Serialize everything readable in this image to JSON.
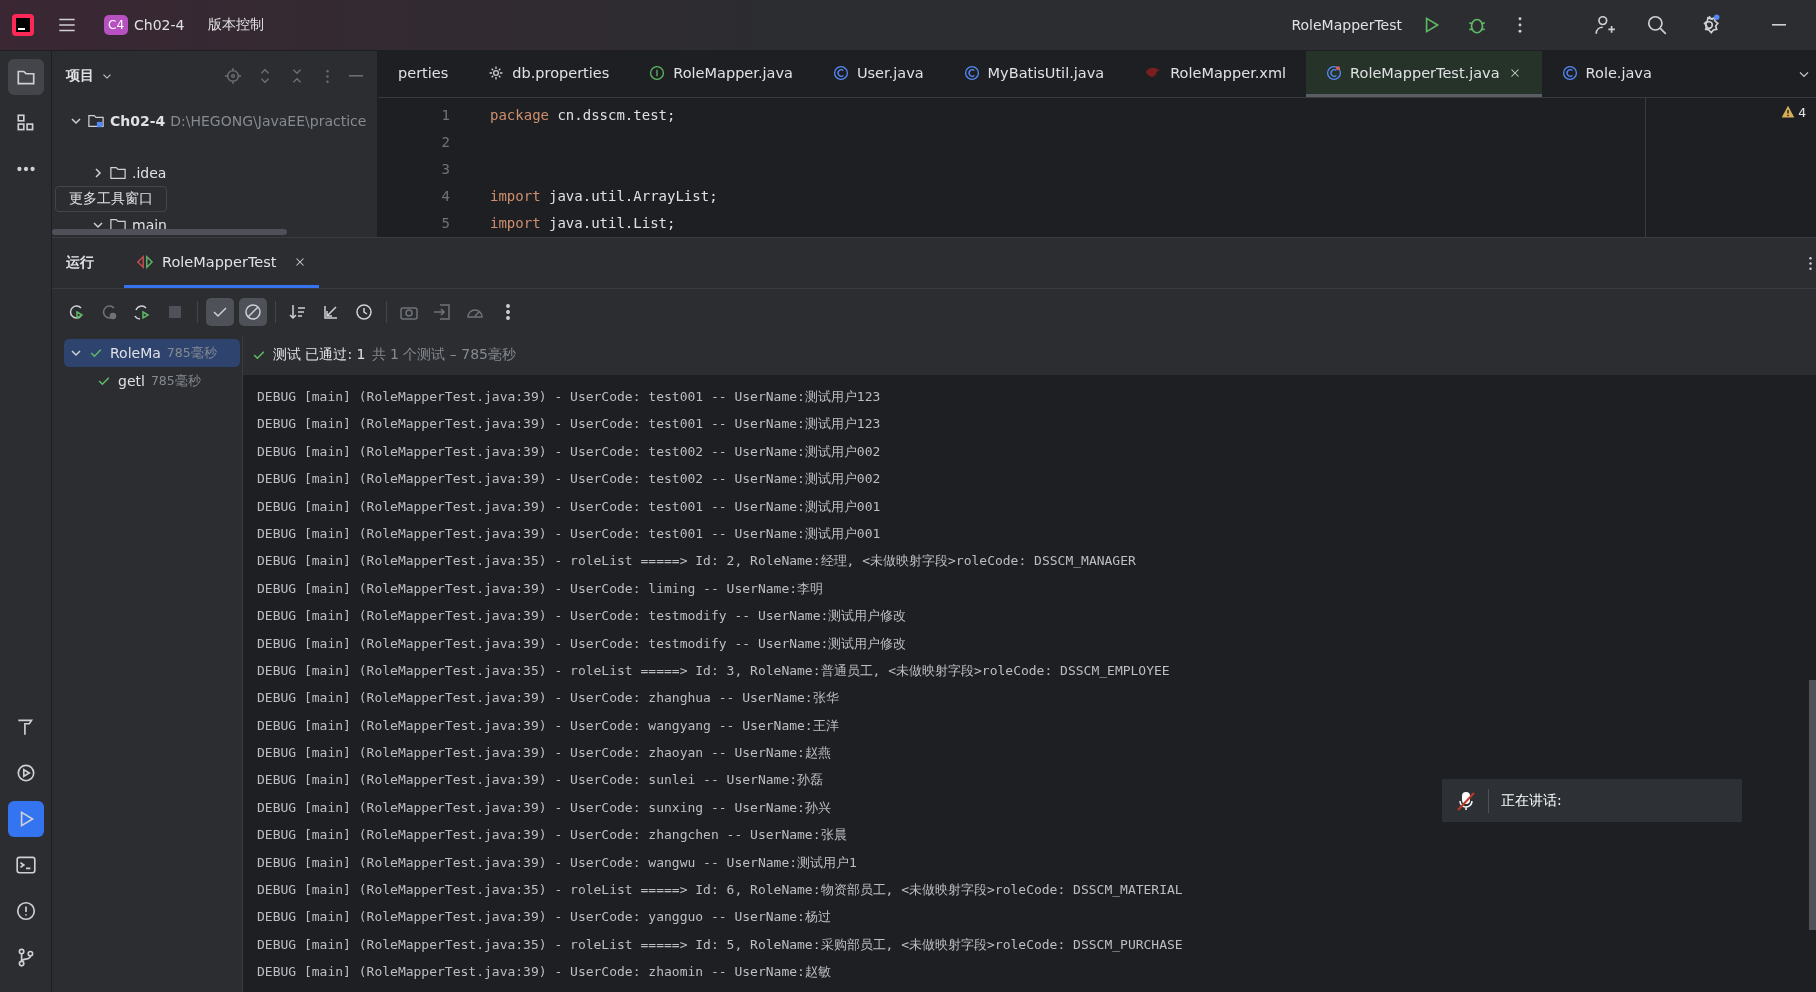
{
  "top_bar": {
    "project_badge": "C4",
    "project": "Ch02-4",
    "vcs": "版本控制",
    "run_config": "RoleMapperTest"
  },
  "tool_strip": {
    "top": [
      {
        "kind": "project",
        "selected": true
      },
      {
        "kind": "structure",
        "selected": false
      },
      {
        "kind": "more",
        "selected": false
      }
    ],
    "bottom": [
      {
        "kind": "build",
        "selected": false
      },
      {
        "kind": "services",
        "selected": false
      },
      {
        "kind": "run",
        "selected": true
      },
      {
        "kind": "terminal",
        "selected": false
      },
      {
        "kind": "problems",
        "selected": false
      },
      {
        "kind": "git",
        "selected": false
      }
    ]
  },
  "tooltip": "更多工具窗口",
  "project_panel": {
    "title": "项目",
    "tree": [
      {
        "label": "Ch02-4",
        "path": "D:\\HEGONG\\JavaEE\\practice",
        "kind": "module",
        "expanded": true,
        "children": [
          {
            "label": ".idea",
            "kind": "folder",
            "expanded": false
          },
          {
            "label": "main",
            "kind": "folder",
            "expanded": true
          }
        ]
      }
    ]
  },
  "editor_tabs": [
    {
      "label": "perties",
      "kind": "none",
      "selected": false
    },
    {
      "label": "db.properties",
      "kind": "gear",
      "selected": false
    },
    {
      "label": "RoleMapper.java",
      "kind": "interface",
      "selected": false
    },
    {
      "label": "User.java",
      "kind": "class",
      "selected": false
    },
    {
      "label": "MyBatisUtil.java",
      "kind": "class",
      "selected": false
    },
    {
      "label": "RoleMapper.xml",
      "kind": "xml",
      "selected": false
    },
    {
      "label": "RoleMapperTest.java",
      "kind": "test",
      "selected": true
    },
    {
      "label": "Role.java",
      "kind": "class",
      "selected": false
    }
  ],
  "code": [
    {
      "number": "1",
      "keyword": "package",
      "text": " cn.dsscm.test;"
    },
    {
      "number": "2"
    },
    {
      "number": "3"
    },
    {
      "number": "4",
      "keyword": "import",
      "text": " java.util.ArrayList;"
    },
    {
      "number": "5",
      "keyword": "import",
      "text": " java.util.List;"
    }
  ],
  "warnings": "4",
  "run_panel": {
    "title": "运行",
    "tabs": [
      {
        "label": "RoleMapperTest",
        "selected": true
      }
    ],
    "toolbar": [
      {
        "kind": "rerun",
        "disabled": false
      },
      {
        "kind": "rerun_failed",
        "disabled": true
      },
      {
        "kind": "toggle_rerun",
        "disabled": false
      },
      {
        "kind": "stop",
        "disabled": true
      },
      {
        "kind": "sep"
      },
      {
        "kind": "show_passed",
        "disabled": false,
        "selected": true
      },
      {
        "kind": "show_ignored",
        "disabled": false,
        "selected": true
      },
      {
        "kind": "sep"
      },
      {
        "kind": "sort",
        "disabled": false
      },
      {
        "kind": "collapse",
        "disabled": false
      },
      {
        "kind": "history",
        "disabled": false
      },
      {
        "kind": "sep"
      },
      {
        "kind": "camera",
        "disabled": true
      },
      {
        "kind": "import",
        "disabled": true
      },
      {
        "kind": "gauge",
        "disabled": true
      },
      {
        "kind": "more",
        "disabled": false
      }
    ],
    "tests": [
      {
        "name": "RoleMa",
        "time": "785毫秒",
        "passed": true,
        "selected": true,
        "expanded": true,
        "children": [
          {
            "name": "getl",
            "time": "785毫秒",
            "passed": true,
            "selected": false
          }
        ]
      }
    ],
    "status": {
      "passed": true,
      "label": "测试 已通过: 1",
      "detail": "共 1 个测试 – 785毫秒"
    },
    "console": [
      "DEBUG [main] (RoleMapperTest.java:39) - UserCode: test001 -- UserName:测试用户123",
      "DEBUG [main] (RoleMapperTest.java:39) - UserCode: test001 -- UserName:测试用户123",
      "DEBUG [main] (RoleMapperTest.java:39) - UserCode: test002 -- UserName:测试用户002",
      "DEBUG [main] (RoleMapperTest.java:39) - UserCode: test002 -- UserName:测试用户002",
      "DEBUG [main] (RoleMapperTest.java:39) - UserCode: test001 -- UserName:测试用户001",
      "DEBUG [main] (RoleMapperTest.java:39) - UserCode: test001 -- UserName:测试用户001",
      "DEBUG [main] (RoleMapperTest.java:35) - roleList =====> Id: 2, RoleName:经理, <未做映射字段>roleCode: DSSCM_MANAGER",
      "DEBUG [main] (RoleMapperTest.java:39) - UserCode: liming -- UserName:李明",
      "DEBUG [main] (RoleMapperTest.java:39) - UserCode: testmodify -- UserName:测试用户修改",
      "DEBUG [main] (RoleMapperTest.java:39) - UserCode: testmodify -- UserName:测试用户修改",
      "DEBUG [main] (RoleMapperTest.java:35) - roleList =====> Id: 3, RoleName:普通员工, <未做映射字段>roleCode: DSSCM_EMPLOYEE",
      "DEBUG [main] (RoleMapperTest.java:39) - UserCode: zhanghua -- UserName:张华",
      "DEBUG [main] (RoleMapperTest.java:39) - UserCode: wangyang -- UserName:王洋",
      "DEBUG [main] (RoleMapperTest.java:39) - UserCode: zhaoyan -- UserName:赵燕",
      "DEBUG [main] (RoleMapperTest.java:39) - UserCode: sunlei -- UserName:孙磊",
      "DEBUG [main] (RoleMapperTest.java:39) - UserCode: sunxing -- UserName:孙兴",
      "DEBUG [main] (RoleMapperTest.java:39) - UserCode: zhangchen -- UserName:张晨",
      "DEBUG [main] (RoleMapperTest.java:39) - UserCode: wangwu -- UserName:测试用户1",
      "DEBUG [main] (RoleMapperTest.java:35) - roleList =====> Id: 6, RoleName:物资部员工, <未做映射字段>roleCode: DSSCM_MATERIAL",
      "DEBUG [main] (RoleMapperTest.java:39) - UserCode: yangguo -- UserName:杨过",
      "DEBUG [main] (RoleMapperTest.java:35) - roleList =====> Id: 5, RoleName:采购部员工, <未做映射字段>roleCode: DSSCM_PURCHASE",
      "DEBUG [main] (RoleMapperTest.java:39) - UserCode: zhaomin -- UserName:赵敏"
    ]
  },
  "speech_overlay": {
    "muted": true,
    "label": "正在讲话:"
  }
}
